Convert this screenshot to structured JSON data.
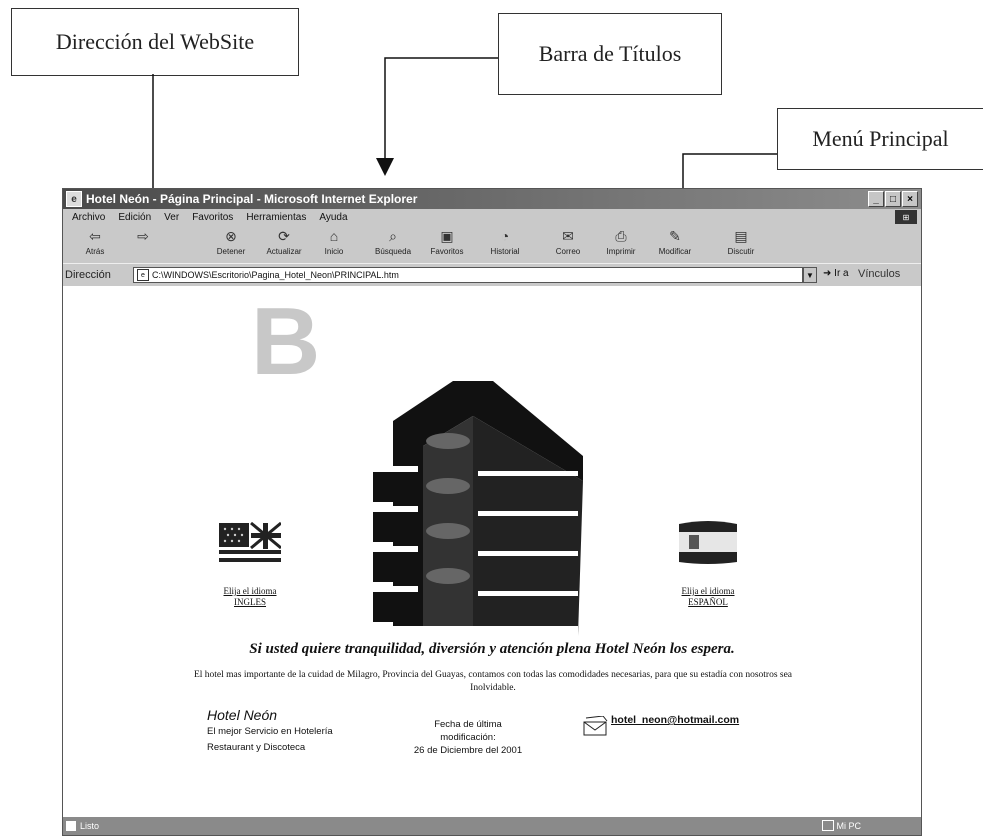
{
  "callouts": {
    "address": "Dirección del WebSite",
    "titlebar": "Barra de Títulos",
    "menu": "Menú Principal"
  },
  "window": {
    "title": "Hotel Neón - Página Principal - Microsoft Internet Explorer",
    "menu": [
      "Archivo",
      "Edición",
      "Ver",
      "Favoritos",
      "Herramientas",
      "Ayuda"
    ],
    "toolbar": {
      "back": "Atrás",
      "stop": "Detener",
      "refresh": "Actualizar",
      "home": "Inicio",
      "search": "Búsqueda",
      "favorites": "Favoritos",
      "history": "Historial",
      "mail": "Correo",
      "print": "Imprimir",
      "edit": "Modificar",
      "discuss": "Discutir"
    },
    "address_label": "Dirección",
    "address_value": "C:\\WINDOWS\\Escritorio\\Pagina_Hotel_Neon\\PRINCIPAL.htm",
    "go_label": "Ir a",
    "links_label": "Vínculos"
  },
  "page": {
    "big_letter": "B",
    "left_flag_caption_1": "Elija el idioma",
    "left_flag_caption_2": "INGLES",
    "right_flag_caption_1": "Elija el idioma",
    "right_flag_caption_2": "ESPAÑOL",
    "slogan": "Si usted quiere tranquilidad, diversión y atención plena Hotel Neón los espera.",
    "intro": "El hotel mas importante de la cuidad de Milagro, Provincia del Guayas, contamos con todas las comodidades necesarias, para que su estadía con nosotros sea Inolvidable.",
    "hotel_name": "Hotel Neón",
    "hotel_line1": "El mejor Servicio en Hotelería",
    "hotel_line2": "Restaurant y Discoteca",
    "fecha_1": "Fecha de última",
    "fecha_2": "modificación:",
    "fecha_3": "26 de Diciembre del 2001",
    "email": "hotel_neon@hotmail.com"
  },
  "status": {
    "left": "Listo",
    "zone": "Mi PC"
  }
}
